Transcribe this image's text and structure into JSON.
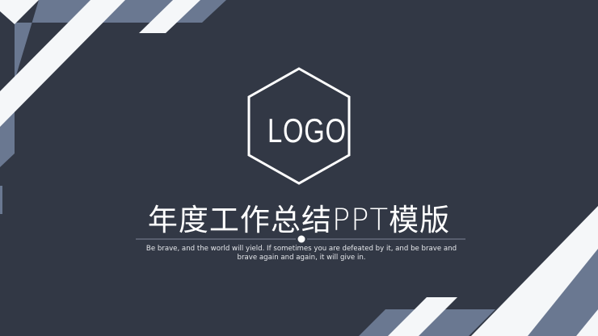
{
  "slide": {
    "logo_text": "LOGO",
    "title": "年度工作总结PPT模版",
    "subtitle_line1": "Be brave, and the world will yield. If sometimes you are defeated by it, and be brave and",
    "subtitle_line2": "brave again and again, it will give in."
  },
  "colors": {
    "background": "#323845",
    "stripe_light": "#f5f7f9",
    "stripe_slate": "#6a7891"
  }
}
